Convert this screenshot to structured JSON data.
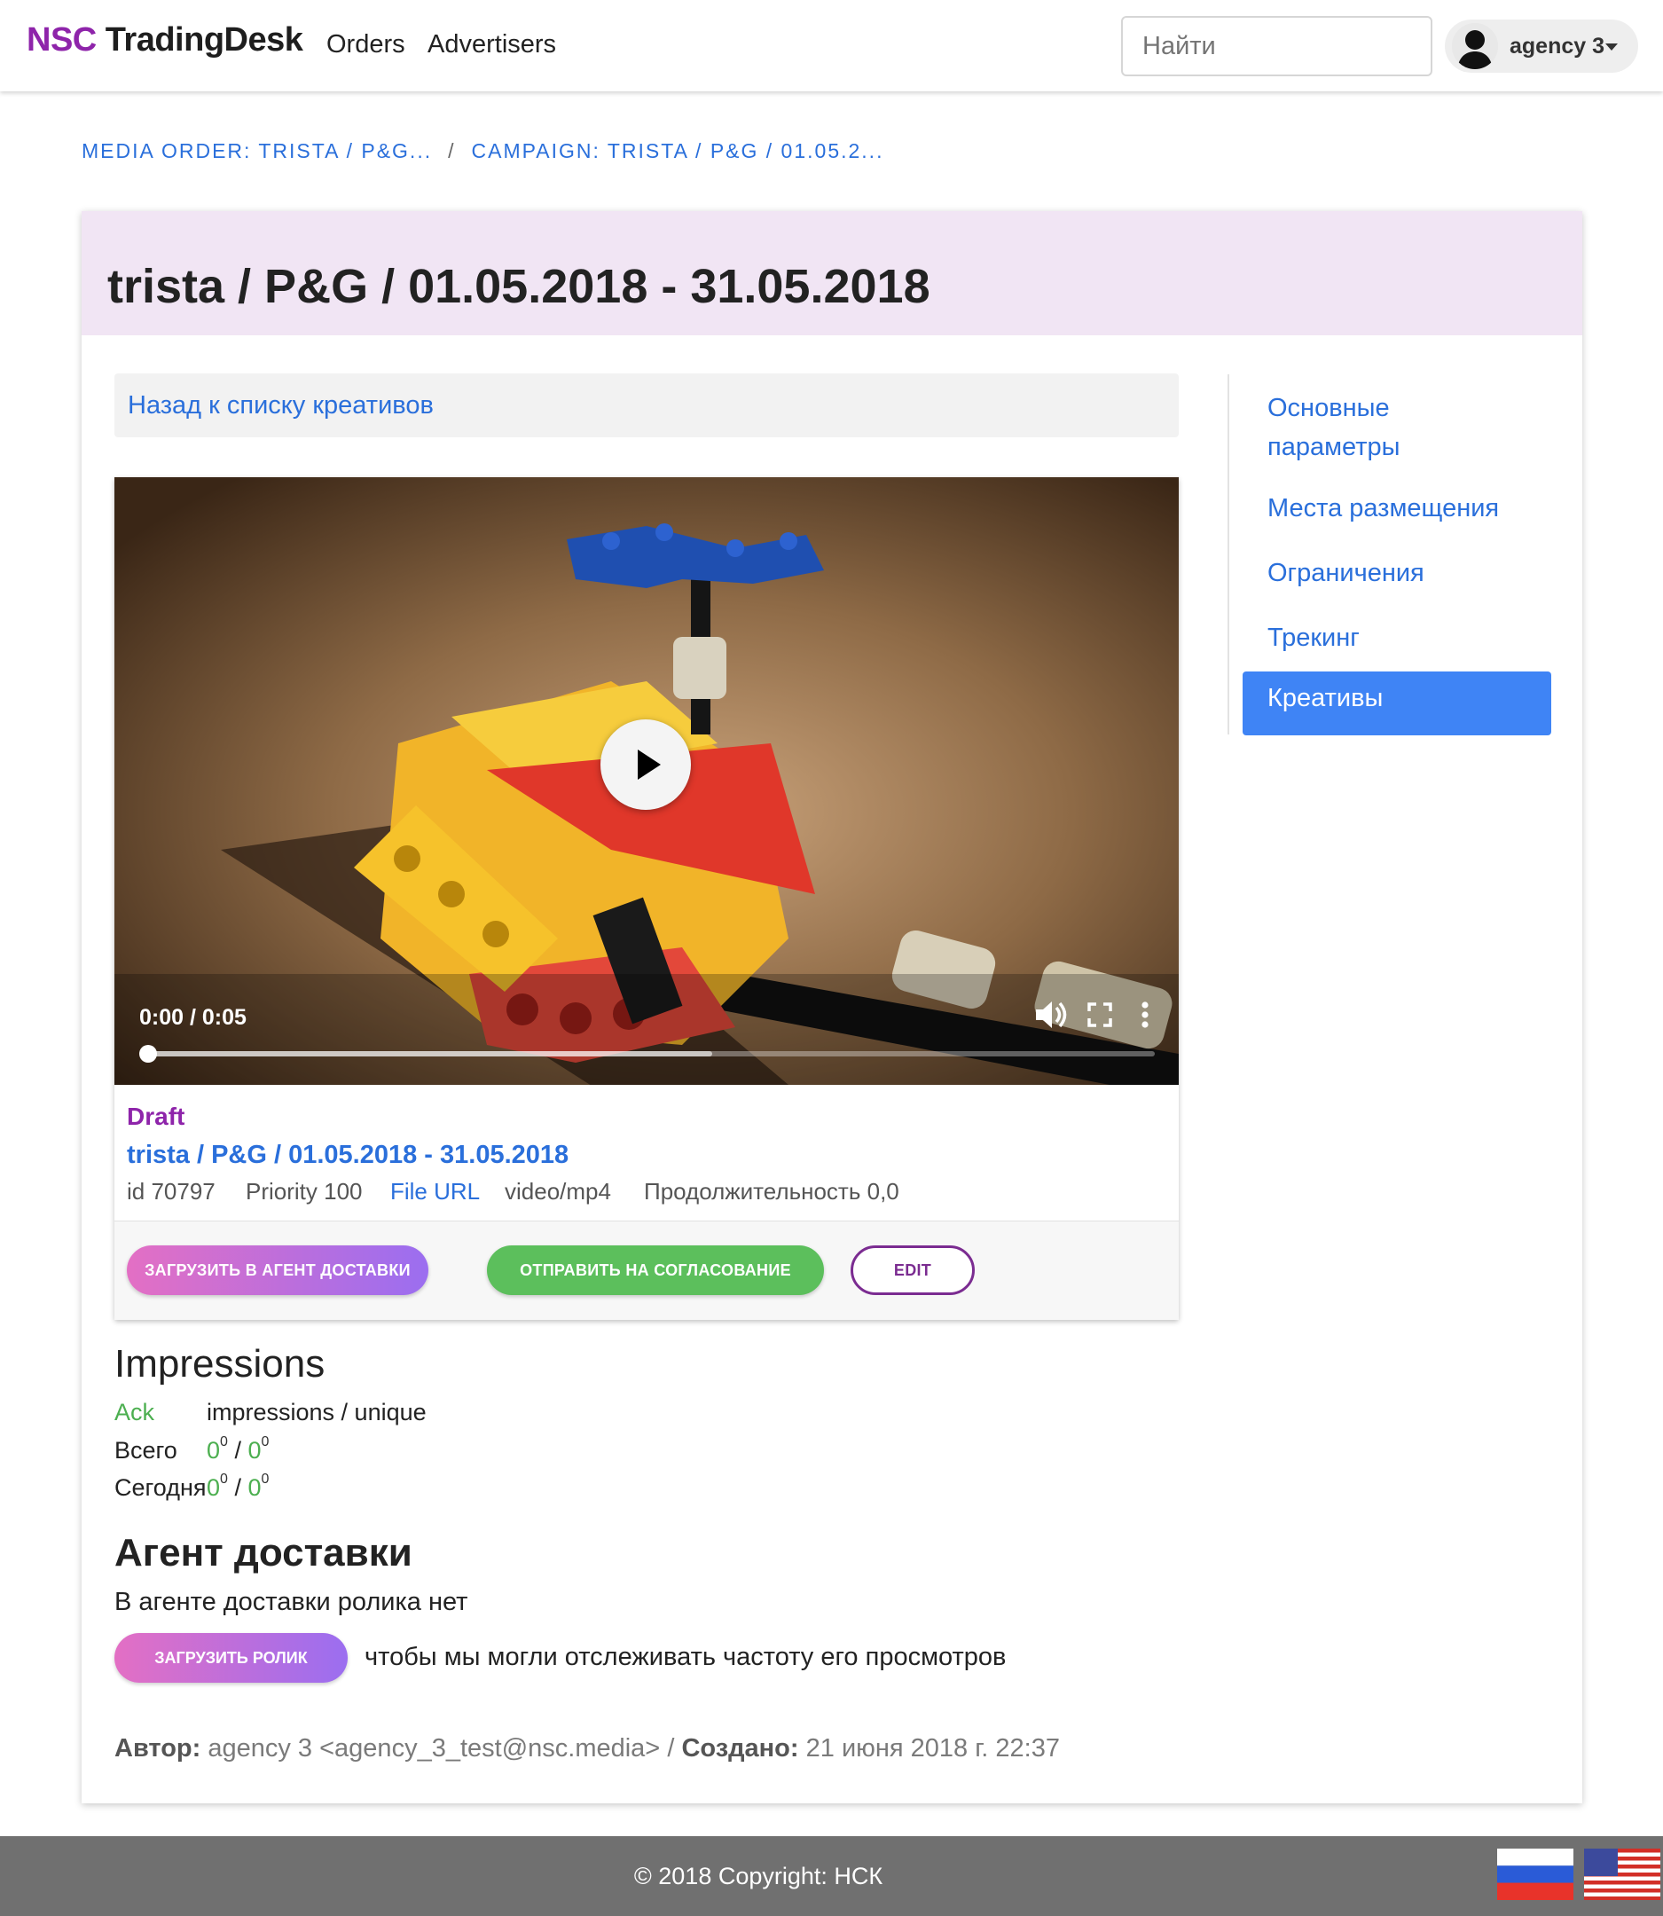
{
  "navbar": {
    "brand_part1": "NSC",
    "brand_part2": "TradingDesk",
    "links": [
      "Orders",
      "Advertisers"
    ],
    "search_placeholder": "Найти",
    "user": "agency 3"
  },
  "breadcrumb": {
    "items": [
      "MEDIA ORDER: TRISTA / P&G...",
      "CAMPAIGN: TRISTA / P&G / 01.05.2..."
    ],
    "separator": "/"
  },
  "page": {
    "title": "trista / P&G / 01.05.2018 - 31.05.2018",
    "back_link": "Назад к списку креативов"
  },
  "video": {
    "time": "0:00 / 0:05",
    "progress_buffered": 0.56
  },
  "creative": {
    "status": "Draft",
    "name": "trista / P&G / 01.05.2018 - 31.05.2018",
    "id": "id 70797",
    "priority": "Priority 100",
    "file_url": "File URL",
    "mime": "video/mp4",
    "duration": "Продолжительность 0,0"
  },
  "actions": {
    "load_agent": "ЗАГРУЗИТЬ В АГЕНТ ДОСТАВКИ",
    "send_approval": "ОТПРАВИТЬ НА СОГЛАСОВАНИЕ",
    "edit": "EDIT"
  },
  "impressions": {
    "heading": "Impressions",
    "ack": "Ack",
    "columns": "impressions / unique",
    "total_label": "Всего",
    "today_label": "Сегодня",
    "total_impressions": "0",
    "total_impressions_sup": "0",
    "total_unique": "0",
    "total_unique_sup": "0",
    "today_impressions": "0",
    "today_impressions_sup": "0",
    "today_unique": "0",
    "today_unique_sup": "0",
    "slash": "/"
  },
  "agent": {
    "heading": "Агент доставки",
    "text": "В агенте доставки ролика нет",
    "upload_button": "ЗАГРУЗИТЬ РОЛИК",
    "note": "чтобы мы могли отслеживать частоту его просмотров"
  },
  "author": {
    "author_label": "Автор:",
    "author_value": "agency 3 <agency_3_test@nsc.media>",
    "sep": "/",
    "created_label": "Создано:",
    "created_value": "21 июня 2018 г. 22:37"
  },
  "sidenav": {
    "items": [
      "Основные",
      "параметры",
      "Места размещения",
      "Ограничения",
      "Трекинг"
    ],
    "active": "Креативы"
  },
  "footer": {
    "copyright": "© 2018 Copyright: НСК"
  },
  "colors": {
    "brand_purple": "#8e24aa",
    "link_blue": "#2a6fdb",
    "active_blue": "#3f84f5",
    "green": "#4caf50"
  }
}
